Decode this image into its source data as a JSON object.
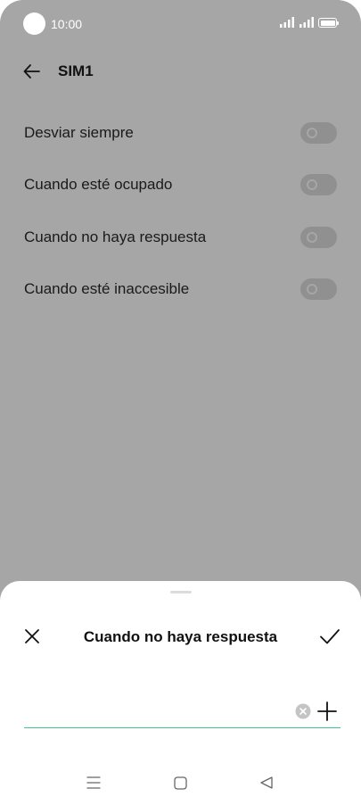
{
  "status_bar": {
    "time": "10:00"
  },
  "header": {
    "title": "SIM1"
  },
  "forwarding_options": [
    {
      "label": "Desviar siempre",
      "enabled": false
    },
    {
      "label": "Cuando esté ocupado",
      "enabled": false
    },
    {
      "label": "Cuando no haya respuesta",
      "enabled": false
    },
    {
      "label": "Cuando esté inaccesible",
      "enabled": false
    }
  ],
  "dialog": {
    "title": "Cuando no haya respuesta",
    "number_value": "",
    "number_placeholder": "",
    "accent_color": "#3ec58c"
  },
  "icons": {
    "back": "arrow-left-icon",
    "close": "close-icon",
    "confirm": "checkmark-icon",
    "clear": "clear-circle-icon",
    "add_contact": "plus-icon",
    "nav_menu": "menu-icon",
    "nav_home": "home-square-icon",
    "nav_back": "triangle-back-icon"
  }
}
